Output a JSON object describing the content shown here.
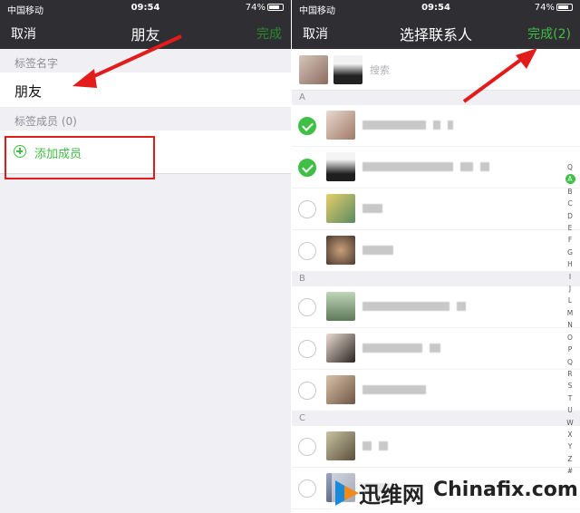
{
  "status": {
    "carrier": "中国移动",
    "time": "09:54",
    "battery": "74%"
  },
  "left": {
    "nav": {
      "cancel": "取消",
      "title": "朋友",
      "done": "完成"
    },
    "tag_name_label": "标签名字",
    "tag_name_value": "朋友",
    "members_label": "标签成员 (0)",
    "add_member": "添加成员"
  },
  "right": {
    "nav": {
      "cancel": "取消",
      "title": "选择联系人",
      "done": "完成(2)"
    },
    "search_placeholder": "搜索",
    "groups": [
      {
        "letter": "A",
        "rows": [
          {
            "checked": true
          },
          {
            "checked": true
          },
          {
            "checked": false
          },
          {
            "checked": false
          }
        ]
      },
      {
        "letter": "B",
        "rows": [
          {
            "checked": false
          },
          {
            "checked": false
          },
          {
            "checked": false
          }
        ]
      },
      {
        "letter": "C",
        "rows": [
          {
            "checked": false
          },
          {
            "checked": false
          }
        ]
      }
    ],
    "index": [
      "Q",
      "A",
      "B",
      "C",
      "D",
      "E",
      "F",
      "G",
      "H",
      "I",
      "J",
      "L",
      "M",
      "N",
      "O",
      "P",
      "Q",
      "R",
      "S",
      "T",
      "U",
      "W",
      "X",
      "Y",
      "Z",
      "#"
    ]
  },
  "watermark": {
    "brand1": "迅维网",
    "brand2": "Chinafix.com"
  },
  "colors": {
    "accent": "#3fbf45",
    "arrow": "#e21b1b",
    "navbar": "#2e2e33"
  }
}
